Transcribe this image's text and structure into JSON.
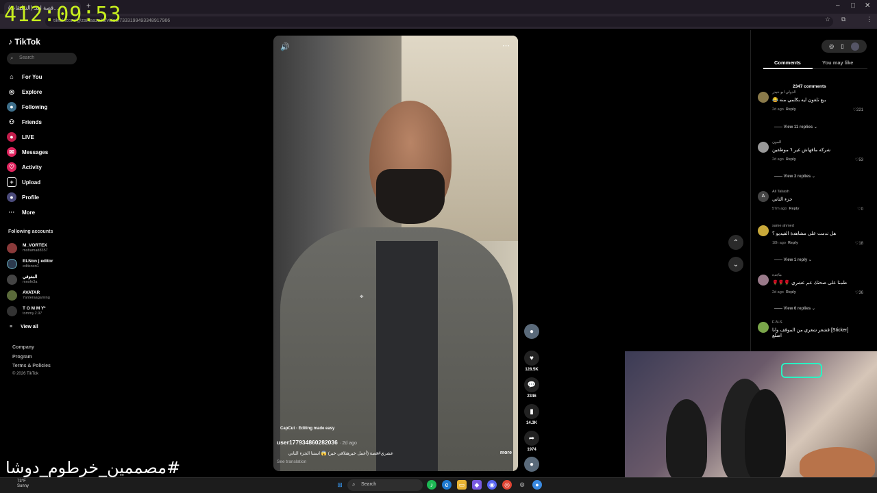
{
  "clock": "412:09:53",
  "browser": {
    "tab_title": "(التعليقات) قصة اسـ...",
    "new_tab": "+",
    "url": "tiktok.com/@zainaazalia/video/7333199493348917966"
  },
  "sidebar": {
    "logo": "TikTok",
    "search_placeholder": "Search",
    "items": [
      {
        "label": "For You",
        "icon": "home-icon"
      },
      {
        "label": "Explore",
        "icon": "compass-icon"
      },
      {
        "label": "Following",
        "icon": "following-icon"
      },
      {
        "label": "Friends",
        "icon": "friends-icon"
      },
      {
        "label": "LIVE",
        "icon": "live-icon"
      },
      {
        "label": "Messages",
        "icon": "messages-icon"
      },
      {
        "label": "Activity",
        "icon": "activity-icon"
      },
      {
        "label": "Upload",
        "icon": "upload-icon"
      },
      {
        "label": "Profile",
        "icon": "profile-icon"
      },
      {
        "label": "More",
        "icon": "more-icon"
      }
    ],
    "following_title": "Following accounts",
    "accounts": [
      {
        "name": "M_VORTEX",
        "handle": "mohamad8357"
      },
      {
        "name": "ELNon | editor",
        "handle": "editsnon1"
      },
      {
        "name": "المتوفي",
        "handle": "mnofe3a"
      },
      {
        "name": "AVATAR",
        "handle": "7anteraagaming"
      },
      {
        "name": "T O M M Y²",
        "handle": "tommy.2.97"
      }
    ],
    "view_all": "View all",
    "footer": [
      "Company",
      "Program",
      "Terms & Policies",
      "© 2026 TikTok"
    ]
  },
  "video": {
    "capcut": "CapCut · Editing made easy",
    "username": "user177934860282036",
    "time": "· 2d ago",
    "description": "عشري#قصة (أعمل خيرهتلاقي خير) 😱 استنا الجزء التاني",
    "see_translation": "See translation",
    "more": "more",
    "likes": "128.5K",
    "comments": "2346",
    "saves": "14.3K",
    "shares": "1974"
  },
  "comments_panel": {
    "tab_comments": "Comments",
    "tab_you_may_like": "You may like",
    "total": "2347 comments",
    "items": [
      {
        "user": "الدولي ابو حيدر",
        "text": "بيع تلفون ليه بكلمي منه 😂",
        "time": "2d ago",
        "reply": "Reply",
        "likes": "221",
        "view_replies": "View 11 replies"
      },
      {
        "user": "المون",
        "text": "شركه مافهاش غير ٦ موظفين",
        "time": "2d ago",
        "reply": "Reply",
        "likes": "53",
        "view_replies": "View 3 replies"
      },
      {
        "user": "Ali Takash",
        "text": "جزء التاني",
        "time": "57m ago",
        "reply": "Reply",
        "likes": "0",
        "view_replies": ""
      },
      {
        "user": "same ahmed",
        "text": "هل ندمت على مشاهدة الفيديو ؟",
        "time": "18h ago",
        "reply": "Reply",
        "likes": "18",
        "view_replies": "View 1 reply"
      },
      {
        "user": "ماجدة",
        "text": "طمنا على صحتك عم عشري 🌹🌹🌹",
        "time": "2d ago",
        "reply": "Reply",
        "likes": "36",
        "view_replies": "View 6 replies"
      },
      {
        "user": "F-N-S",
        "text": "[Sticker] قشعر شعري من الموقف وانا اصلع",
        "time": "",
        "reply": "",
        "likes": "",
        "view_replies": ""
      }
    ]
  },
  "overlay_text": "#مصممين_خرطوم_دوشا",
  "taskbar": {
    "weather_temp": "73°F",
    "weather_desc": "Sunny",
    "search": "Search"
  }
}
